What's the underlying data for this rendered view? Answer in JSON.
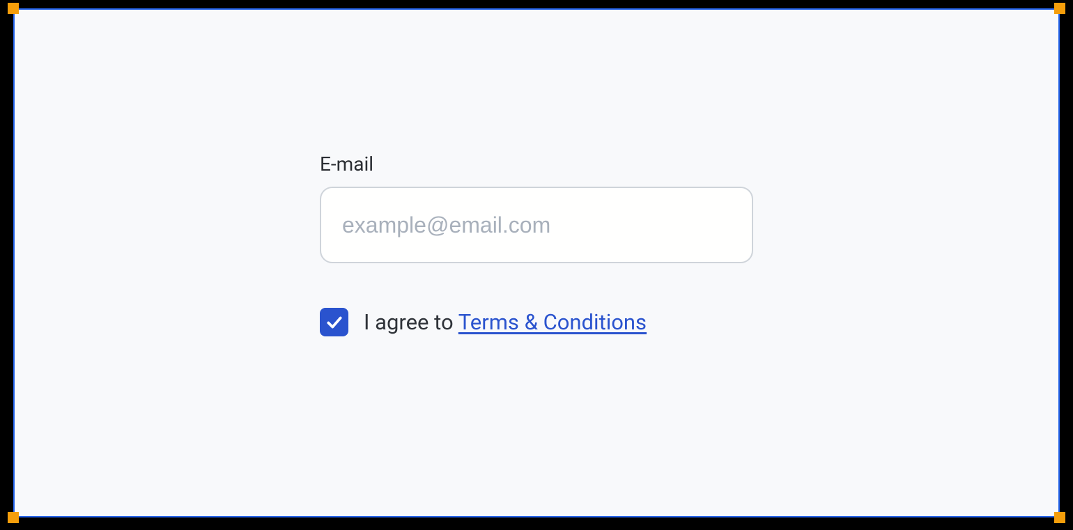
{
  "form": {
    "email_label": "E-mail",
    "email_placeholder": "example@email.com",
    "email_value": "",
    "agree_text_prefix": "I agree to ",
    "terms_link_text": "Terms & Conditions",
    "checkbox_checked": true
  }
}
